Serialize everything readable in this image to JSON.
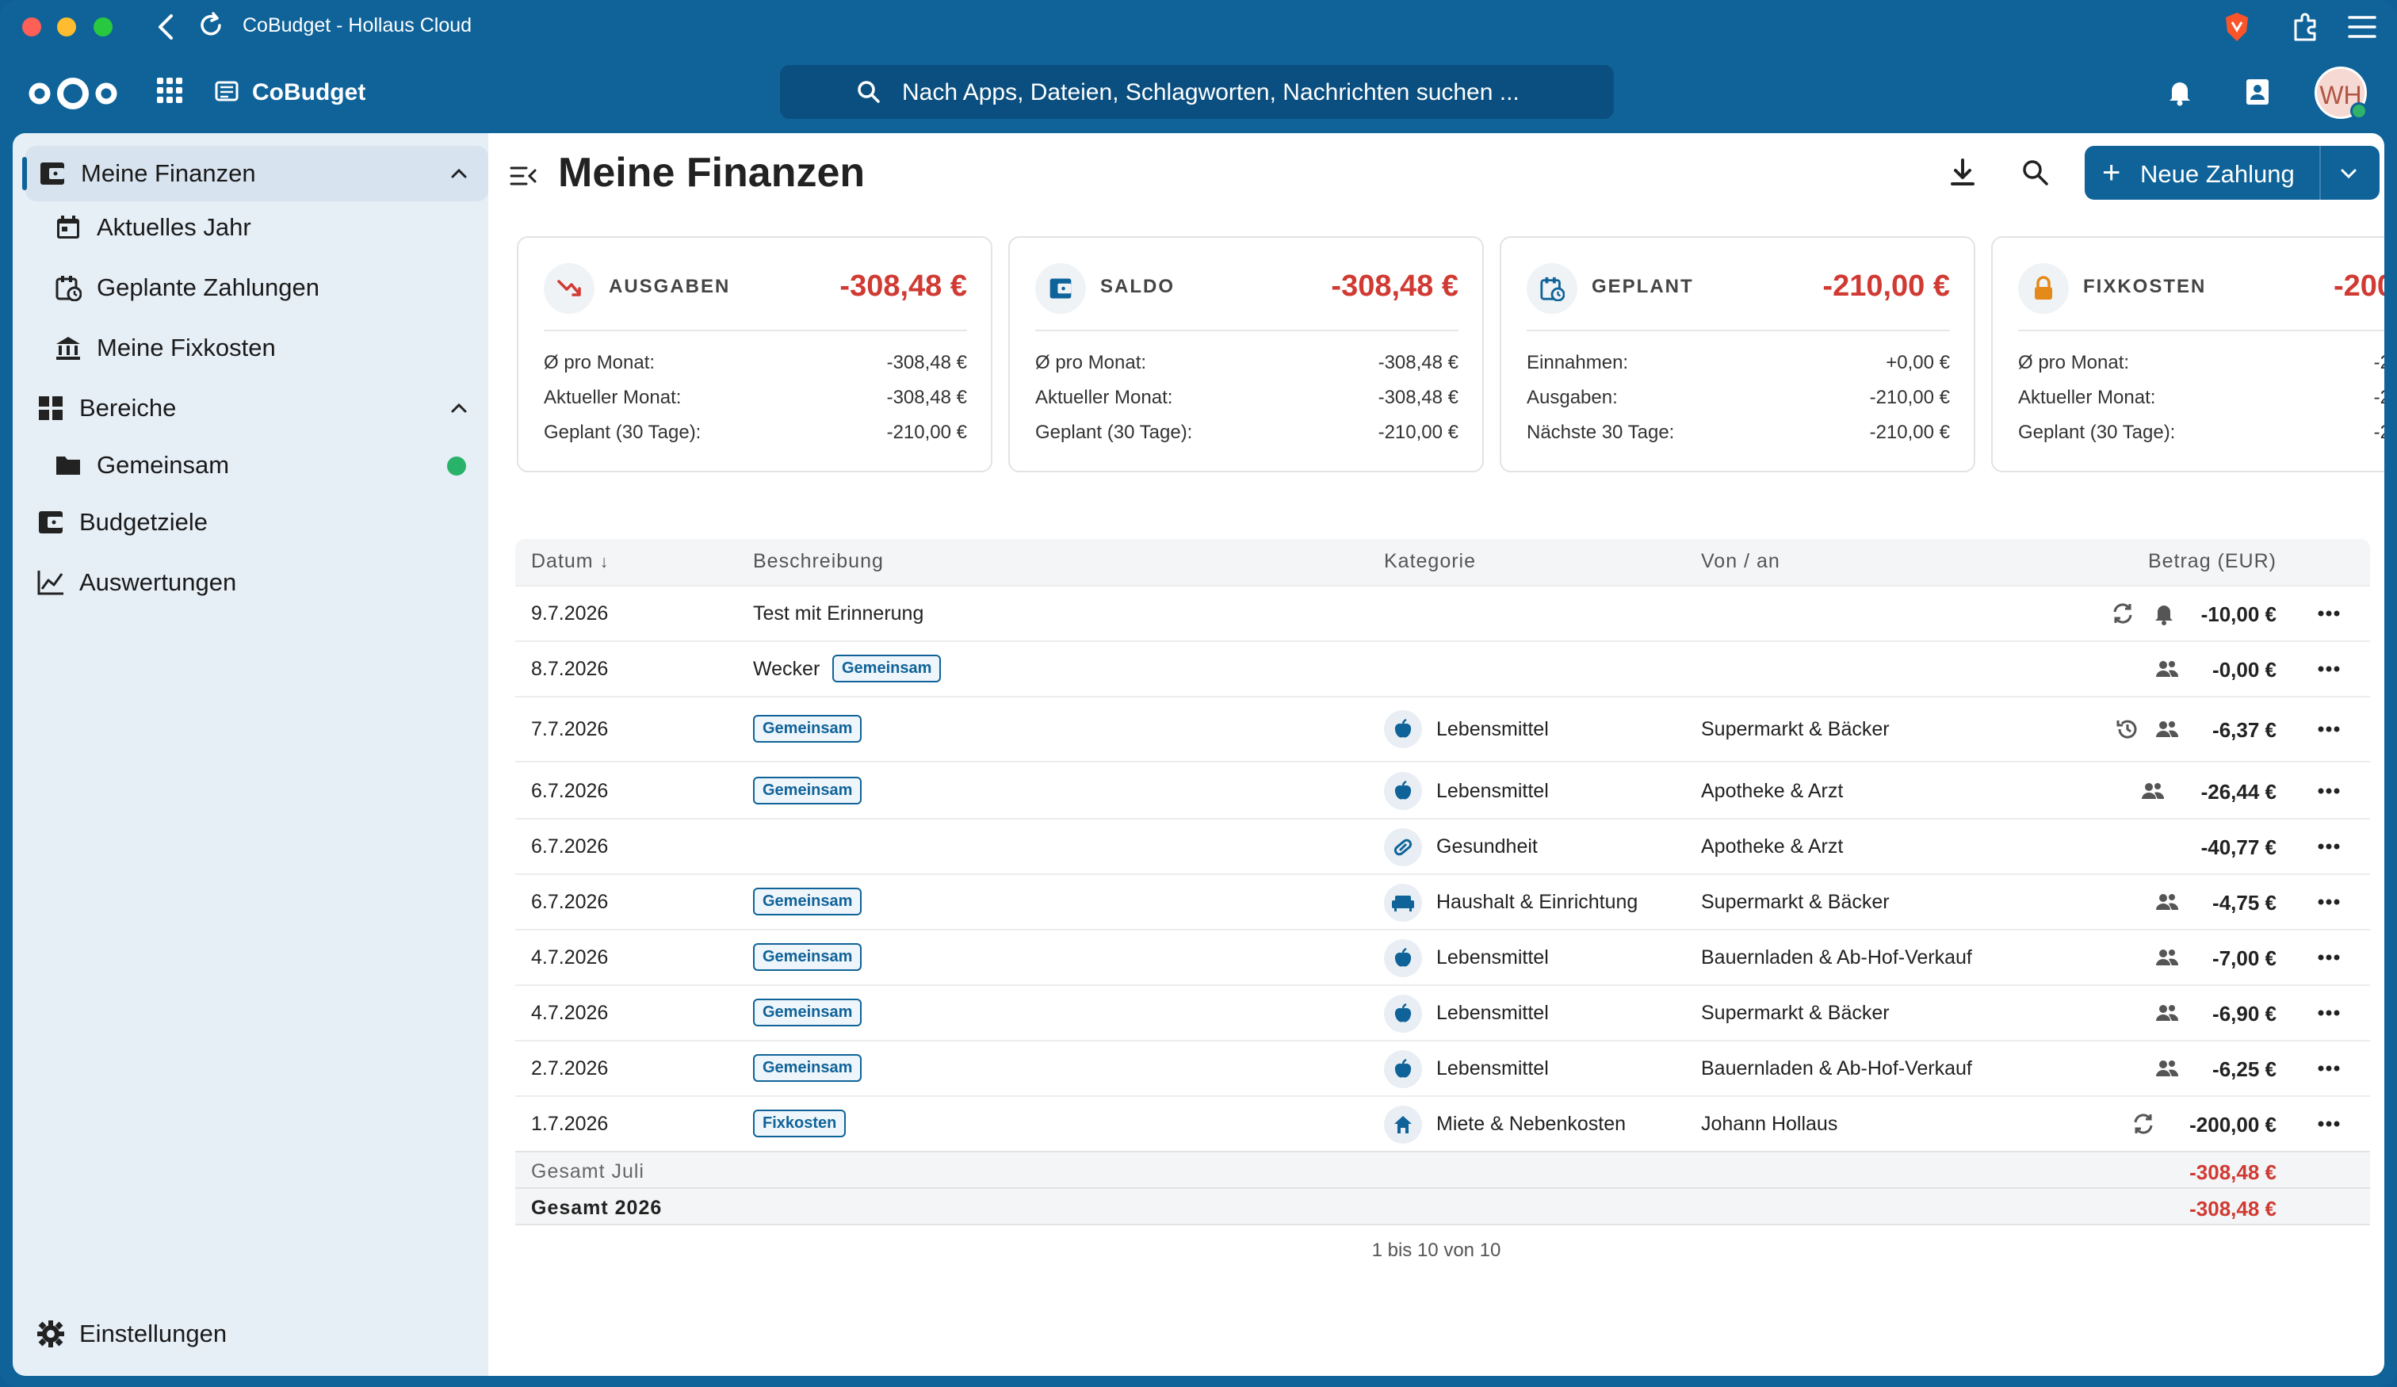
{
  "browser": {
    "tab_title": "CoBudget - Hollaus Cloud"
  },
  "header": {
    "app_name": "CoBudget",
    "search_placeholder": "Nach Apps, Dateien, Schlagworten, Nachrichten suchen ...",
    "avatar_initials": "WH"
  },
  "sidebar": {
    "items": [
      {
        "label": "Meine Finanzen"
      },
      {
        "label": "Aktuelles Jahr"
      },
      {
        "label": "Geplante Zahlungen"
      },
      {
        "label": "Meine Fixkosten"
      },
      {
        "label": "Bereiche"
      },
      {
        "label": "Gemeinsam"
      },
      {
        "label": "Budgetziele"
      },
      {
        "label": "Auswertungen"
      }
    ],
    "settings_label": "Einstellungen"
  },
  "main": {
    "title": "Meine Finanzen",
    "new_payment_label": "Neue Zahlung",
    "cards": [
      {
        "title": "AUSGABEN",
        "value": "-308,48 €",
        "rows": [
          {
            "k": "Ø pro Monat:",
            "v": "-308,48 €"
          },
          {
            "k": "Aktueller Monat:",
            "v": "-308,48 €"
          },
          {
            "k": "Geplant (30 Tage):",
            "v": "-210,00 €"
          }
        ]
      },
      {
        "title": "SALDO",
        "value": "-308,48 €",
        "rows": [
          {
            "k": "Ø pro Monat:",
            "v": "-308,48 €"
          },
          {
            "k": "Aktueller Monat:",
            "v": "-308,48 €"
          },
          {
            "k": "Geplant (30 Tage):",
            "v": "-210,00 €"
          }
        ]
      },
      {
        "title": "GEPLANT",
        "value": "-210,00 €",
        "rows": [
          {
            "k": "Einnahmen:",
            "v": "+0,00 €"
          },
          {
            "k": "Ausgaben:",
            "v": "-210,00 €"
          },
          {
            "k": "Nächste 30 Tage:",
            "v": "-210,00 €"
          }
        ]
      },
      {
        "title": "FIXKOSTEN",
        "value": "-200",
        "rows": [
          {
            "k": "Ø pro Monat:",
            "v": "-2"
          },
          {
            "k": "Aktueller Monat:",
            "v": "-2"
          },
          {
            "k": "Geplant (30 Tage):",
            "v": "-2"
          }
        ]
      }
    ],
    "table": {
      "headers": {
        "date": "Datum",
        "description": "Beschreibung",
        "category": "Kategorie",
        "party": "Von / an",
        "amount": "Betrag (EUR)"
      },
      "rows": [
        {
          "date": "9.7.2026",
          "desc": "Test mit Erinnerung",
          "tag": "",
          "category": "",
          "party": "",
          "amount": "-10,00 €"
        },
        {
          "date": "8.7.2026",
          "desc": "Wecker",
          "tag": "Gemeinsam",
          "category": "",
          "party": "",
          "amount": "-0,00 €"
        },
        {
          "date": "7.7.2026",
          "desc": "",
          "tag": "Gemeinsam",
          "category": "Lebensmittel",
          "party": "Supermarkt & Bäcker",
          "amount": "-6,37 €"
        },
        {
          "date": "6.7.2026",
          "desc": "",
          "tag": "Gemeinsam",
          "category": "Lebensmittel",
          "party": "Apotheke & Arzt",
          "amount": "-26,44 €"
        },
        {
          "date": "6.7.2026",
          "desc": "",
          "tag": "",
          "category": "Gesundheit",
          "party": "Apotheke & Arzt",
          "amount": "-40,77 €"
        },
        {
          "date": "6.7.2026",
          "desc": "",
          "tag": "Gemeinsam",
          "category": "Haushalt & Einrichtung",
          "party": "Supermarkt & Bäcker",
          "amount": "-4,75 €"
        },
        {
          "date": "4.7.2026",
          "desc": "",
          "tag": "Gemeinsam",
          "category": "Lebensmittel",
          "party": "Bauernladen & Ab-Hof-Verkauf",
          "amount": "-7,00 €"
        },
        {
          "date": "4.7.2026",
          "desc": "",
          "tag": "Gemeinsam",
          "category": "Lebensmittel",
          "party": "Supermarkt & Bäcker",
          "amount": "-6,90 €"
        },
        {
          "date": "2.7.2026",
          "desc": "",
          "tag": "Gemeinsam",
          "category": "Lebensmittel",
          "party": "Bauernladen & Ab-Hof-Verkauf",
          "amount": "-6,25 €"
        },
        {
          "date": "1.7.2026",
          "desc": "",
          "tag": "Fixkosten",
          "category": "Miete & Nebenkosten",
          "party": "Johann Hollaus",
          "amount": "-200,00 €"
        }
      ],
      "totals": [
        {
          "label": "Gesamt Juli",
          "value": "-308,48 €"
        },
        {
          "label": "Gesamt 2026",
          "value": "-308,48 €"
        }
      ],
      "pagination": "1 bis 10 von 10"
    }
  },
  "colors": {
    "brand": "#0f6399",
    "negative": "#d03a33",
    "online": "#29b36a"
  }
}
